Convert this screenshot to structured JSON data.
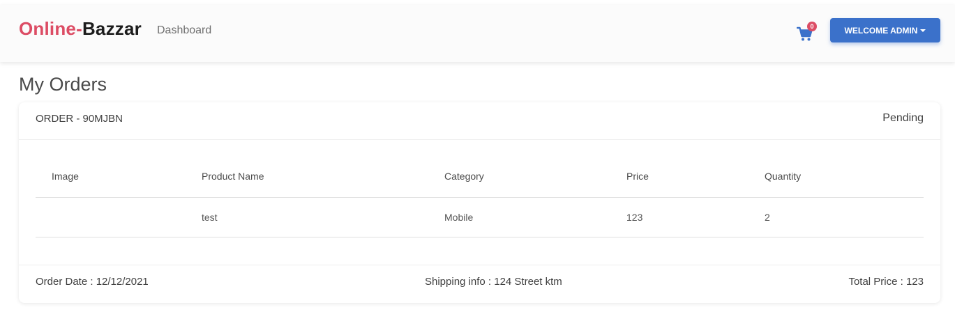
{
  "brand": {
    "part1": "Online-",
    "part2": "Bazzar"
  },
  "nav": {
    "dashboard_label": "Dashboard"
  },
  "cart": {
    "count": "0"
  },
  "user_menu": {
    "label": "WELCOME ADMIN"
  },
  "page": {
    "title": "My Orders"
  },
  "order": {
    "id_label": "ORDER - 90MJBN",
    "status": "Pending",
    "table": {
      "headers": [
        "Image",
        "Product Name",
        "Category",
        "Price",
        "Quantity"
      ],
      "rows": [
        {
          "image": "",
          "name": "test",
          "category": "Mobile",
          "price": "123",
          "quantity": "2"
        }
      ]
    },
    "footer": {
      "date": "Order Date : 12/12/2021",
      "shipping": "Shipping info : 124 Street ktm",
      "total": "Total Price : 123"
    }
  },
  "colors": {
    "brand_red": "#dc4c64",
    "primary": "#3b71ca",
    "navbar_bg": "#fbfbfb"
  }
}
